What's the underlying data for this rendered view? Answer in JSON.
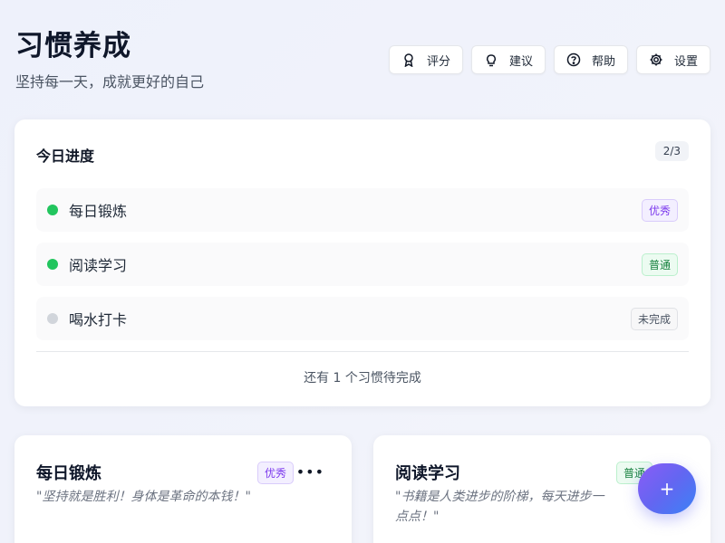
{
  "header": {
    "title": "习惯养成",
    "subtitle": "坚持每一天，成就更好的自己"
  },
  "toolbar": {
    "buttons": [
      {
        "label": "评分",
        "icon": "award-icon"
      },
      {
        "label": "建议",
        "icon": "lightbulb-icon"
      },
      {
        "label": "帮助",
        "icon": "help-icon"
      },
      {
        "label": "设置",
        "icon": "gear-icon"
      }
    ]
  },
  "progress": {
    "title": "今日进度",
    "count": "2/3",
    "habits": [
      {
        "name": "每日锻炼",
        "status": "done",
        "tag": "优秀"
      },
      {
        "name": "阅读学习",
        "status": "done",
        "tag": "普通"
      },
      {
        "name": "喝水打卡",
        "status": "todo",
        "tag": "未完成"
      }
    ],
    "footer": "还有 1 个习惯待完成"
  },
  "cards": [
    {
      "title": "每日锻炼",
      "tag": "优秀",
      "quote": "\"坚持就是胜利！身体是革命的本钱！\""
    },
    {
      "title": "阅读学习",
      "tag": "普通",
      "quote": "\"书籍是人类进步的阶梯，每天进步一点点！\""
    }
  ],
  "fab": {
    "label": "+"
  },
  "colors": {
    "done": "#22c55e",
    "todo": "#d1d5db",
    "accent_start": "#8b5cf6",
    "accent_end": "#3b82f6"
  }
}
